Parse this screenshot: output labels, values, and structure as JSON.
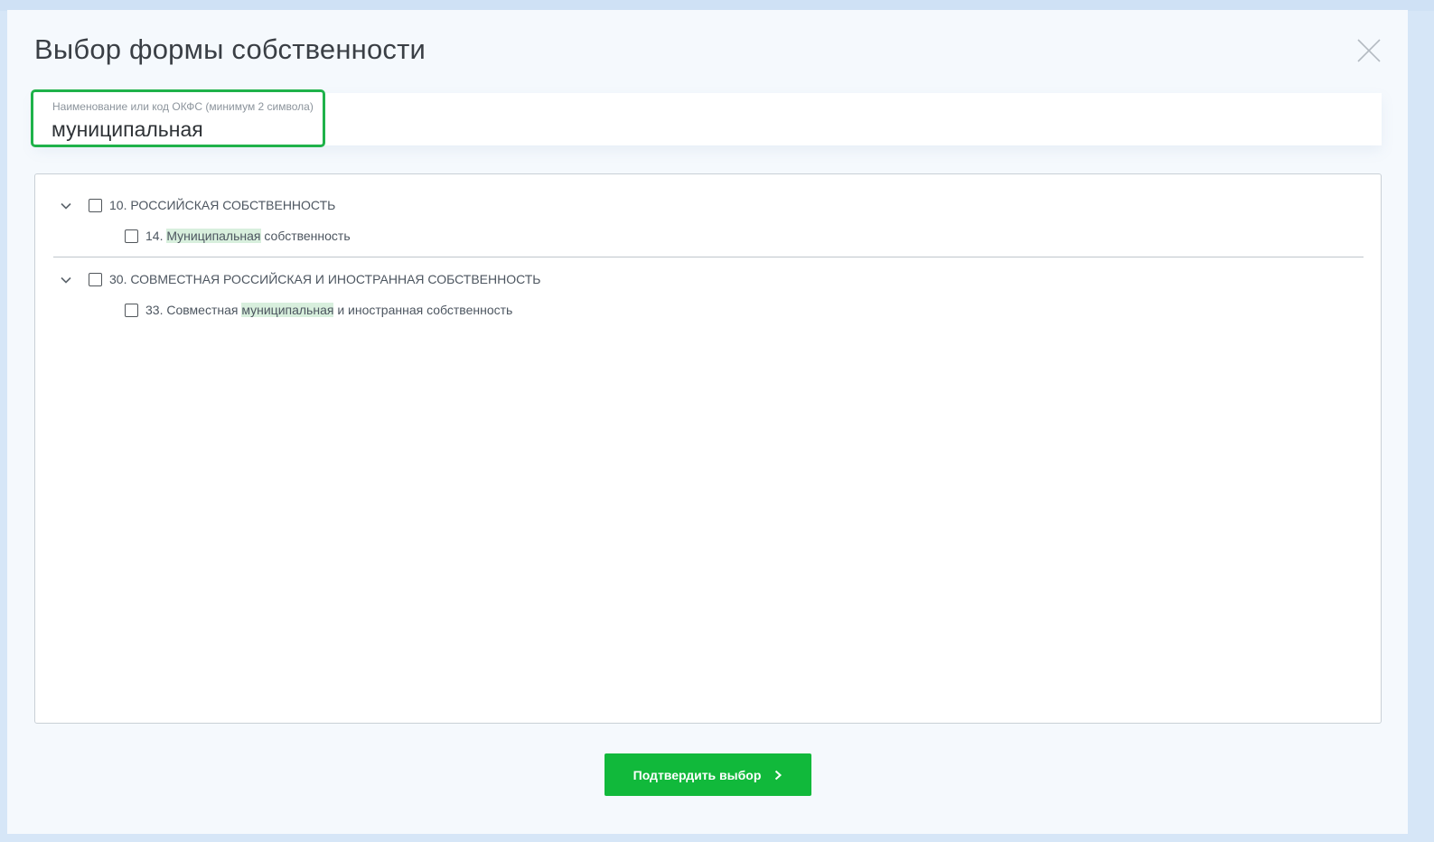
{
  "dialog": {
    "title": "Выбор формы собственности",
    "close_icon": "close-icon"
  },
  "search": {
    "label": "Наименование или код ОКФС (минимум 2 символа)",
    "value": "муниципальная",
    "border_color": "#1fb24a"
  },
  "tree": {
    "highlight_color": "#d8efdd",
    "groups": [
      {
        "label": "10. РОССИЙСКАЯ СОБСТВЕННОСТЬ",
        "expanded": true,
        "checked": false,
        "children": [
          {
            "prefix": "14. ",
            "match": "Муниципальная",
            "suffix": " собственность",
            "checked": false
          }
        ]
      },
      {
        "label": "30. СОВМЕСТНАЯ РОССИЙСКАЯ И ИНОСТРАННАЯ СОБСТВЕННОСТЬ",
        "expanded": true,
        "checked": false,
        "children": [
          {
            "prefix": "33. Совместная ",
            "match": "муниципальная",
            "suffix": " и иностранная собственность",
            "checked": false
          }
        ]
      }
    ]
  },
  "footer": {
    "confirm_label": "Подтвердить выбор",
    "confirm_color": "#11b93b",
    "confirm_icon": "chevron-right-icon"
  }
}
